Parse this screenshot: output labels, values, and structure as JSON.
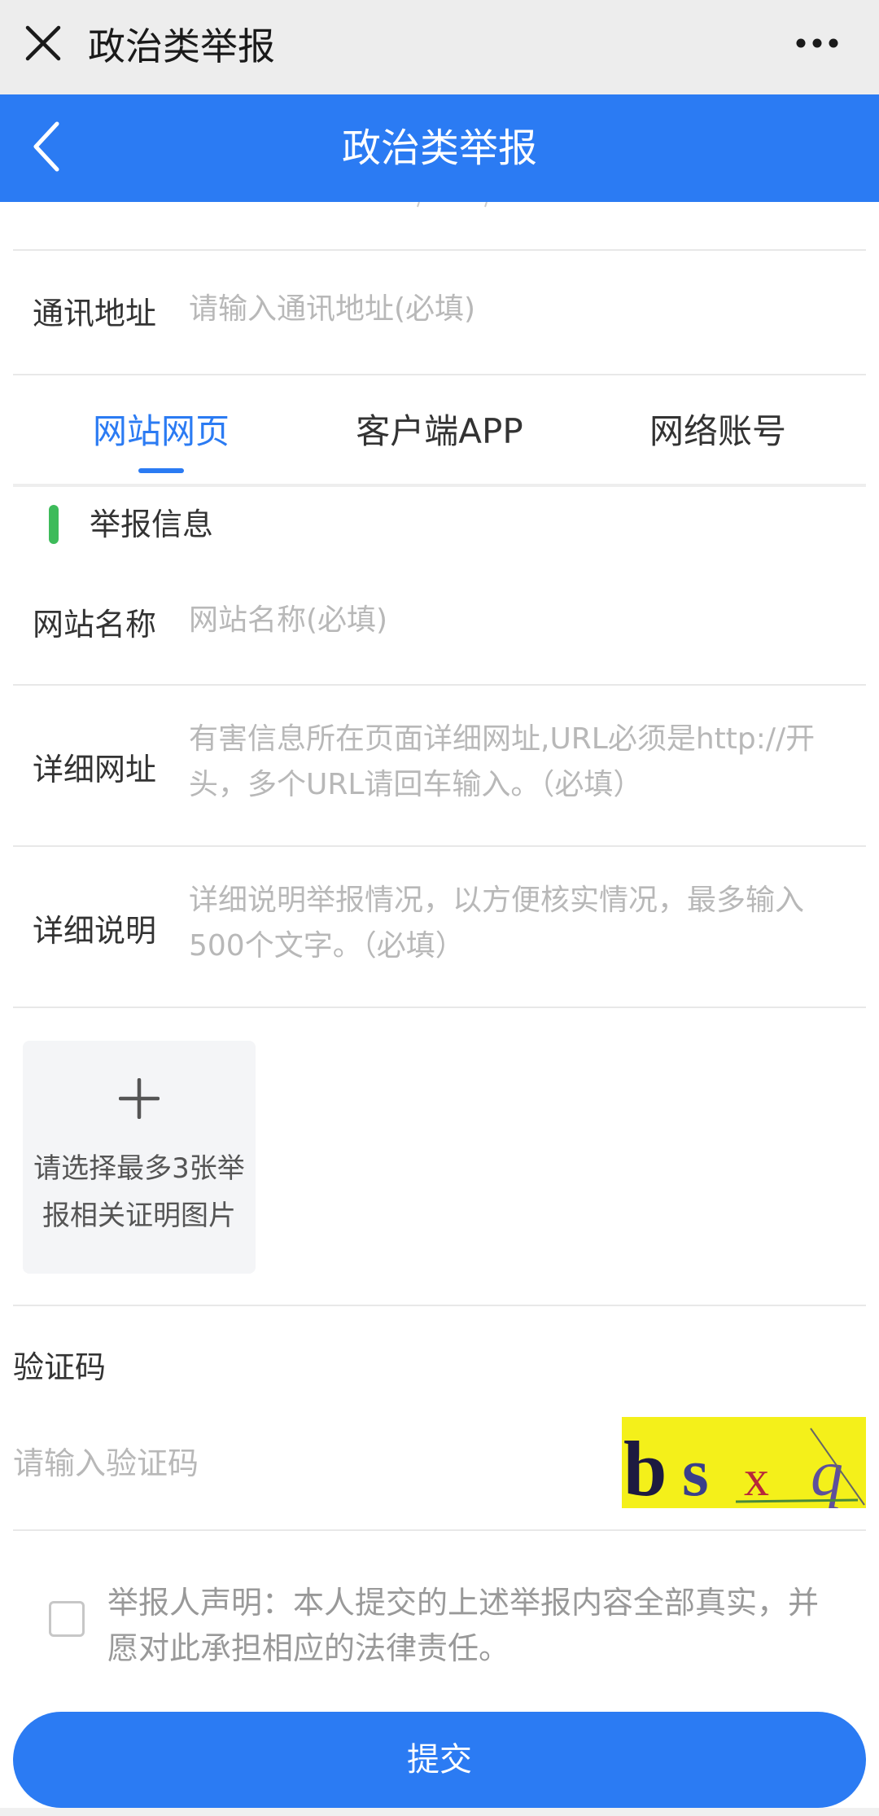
{
  "wechat_bar": {
    "title": "政治类举报",
    "close_icon": "close-icon",
    "more_icon": "more-icon"
  },
  "header": {
    "title": "政治类举报",
    "back_icon": "chevron-left-icon",
    "accent_color": "#2b7bf3"
  },
  "address_row": {
    "label": "通讯地址",
    "placeholder": "请输入通讯地址(必填)"
  },
  "tabs": [
    {
      "label": "网站网页",
      "active": true
    },
    {
      "label": "客户端APP",
      "active": false
    },
    {
      "label": "网络账号",
      "active": false
    }
  ],
  "section": {
    "title": "举报信息",
    "marker_color": "#3dbb5a"
  },
  "fields": {
    "site_name": {
      "label": "网站名称",
      "placeholder": "网站名称(必填)"
    },
    "detail_url": {
      "label": "详细网址",
      "placeholder": "有害信息所在页面详细网址,URL必须是http://开头，多个URL请回车输入。（必填）"
    },
    "detail_desc": {
      "label": "详细说明",
      "placeholder": "详细说明举报情况，以方便核实情况，最多输入500个文字。（必填）"
    }
  },
  "upload": {
    "icon": "plus-icon",
    "text": "请选择最多3张举报相关证明图片"
  },
  "captcha": {
    "label": "验证码",
    "placeholder": "请输入验证码",
    "image_text": "bsxq"
  },
  "declaration": {
    "checked": false,
    "text": "举报人声明：本人提交的上述举报内容全部真实，并愿对此承担相应的法律责任。"
  },
  "submit": {
    "label": "提交"
  }
}
